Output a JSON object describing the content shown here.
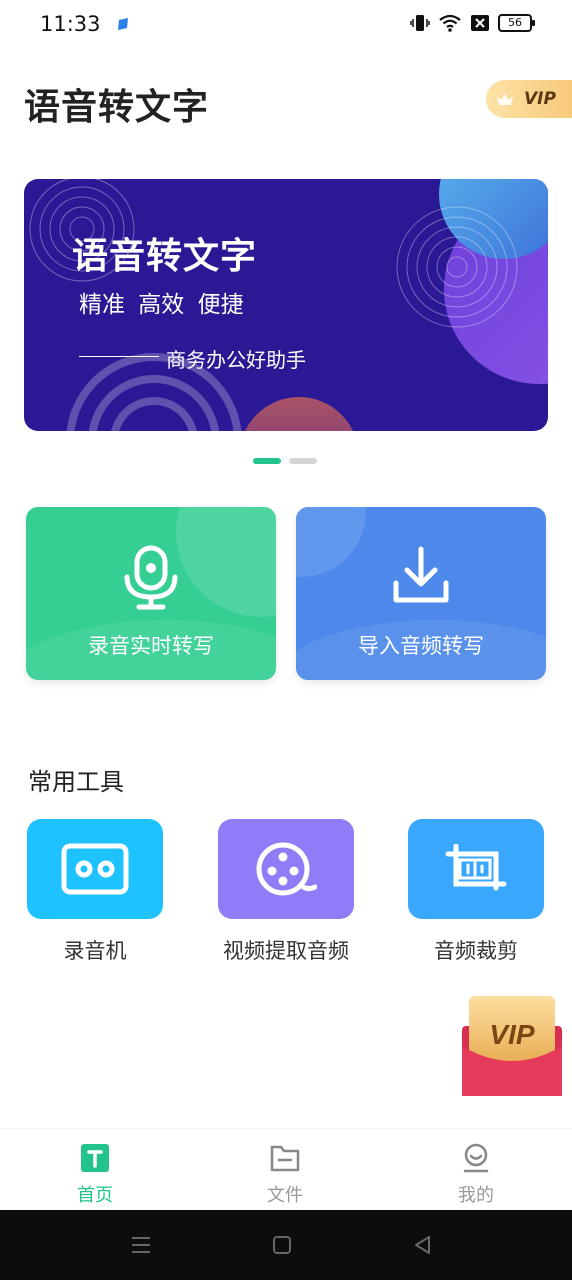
{
  "status_bar": {
    "time": "11:33",
    "battery": "56"
  },
  "header": {
    "title": "语音转文字",
    "vip_label": "VIP"
  },
  "banner": {
    "title": "语音转文字",
    "subtitle": "精准 高效 便捷",
    "tagline": "商务办公好助手",
    "page_count": 2,
    "active_page": 1
  },
  "actions": {
    "record_label": "录音实时转写",
    "import_label": "导入音频转写"
  },
  "tools": {
    "section_title": "常用工具",
    "items": [
      {
        "label": "录音机",
        "icon": "cassette-icon",
        "color": "#1ec2ff"
      },
      {
        "label": "视频提取音频",
        "icon": "film-reel-icon",
        "color": "#8f7cf7"
      },
      {
        "label": "音频裁剪",
        "icon": "crop-audio-icon",
        "color": "#3aa7ff"
      }
    ]
  },
  "float_badge": {
    "label": "VIP"
  },
  "bottom_nav": {
    "items": [
      {
        "label": "首页",
        "icon": "home-t-icon"
      },
      {
        "label": "文件",
        "icon": "folder-icon"
      },
      {
        "label": "我的",
        "icon": "profile-icon"
      }
    ],
    "active": "首页"
  },
  "colors": {
    "accent": "#22c48c",
    "banner_bg": "#2a1894",
    "import_card": "#4c89ea",
    "record_card": "#35cf93"
  }
}
